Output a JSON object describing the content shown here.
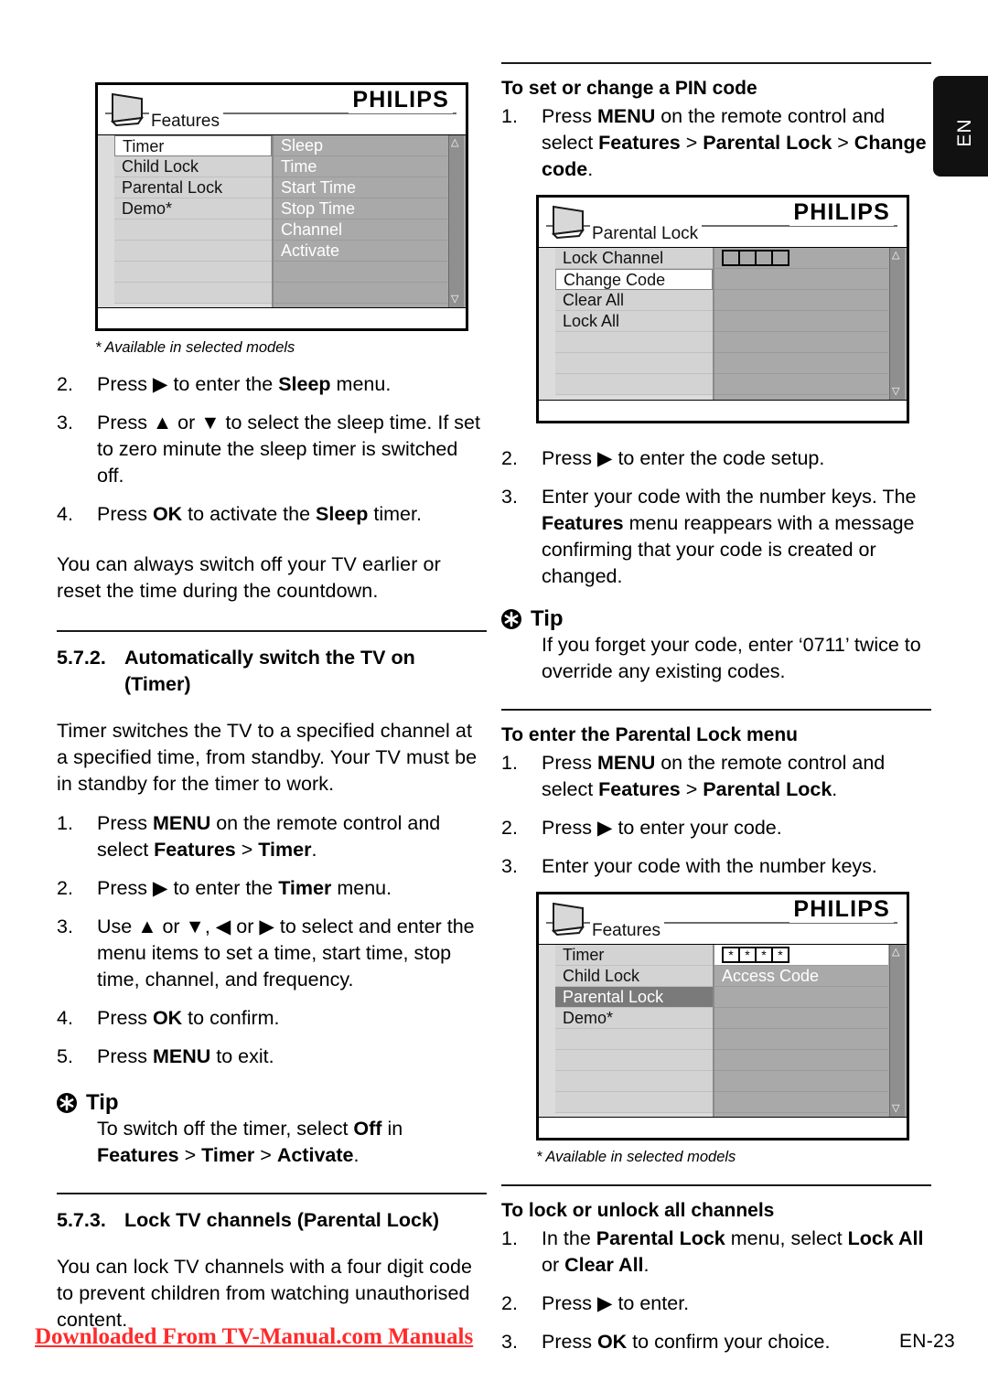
{
  "language_tab": {
    "label": "EN"
  },
  "footer": {
    "download_note": "Downloaded From TV-Manual.com Manuals",
    "page_number": "EN-23"
  },
  "osd_features_timer": {
    "title": "Features",
    "brand": "PHILIPS",
    "left_items": [
      "Timer",
      "Child Lock",
      "Parental Lock",
      "Demo*"
    ],
    "left_selected": "Timer",
    "right_items": [
      "Sleep",
      "Time",
      "Start Time",
      "Stop Time",
      "Channel",
      "Activate"
    ],
    "scroll_up": "△",
    "scroll_down": "▽",
    "note": "* Available in selected models"
  },
  "osd_parental_lock": {
    "title": "Parental Lock",
    "brand": "PHILIPS",
    "left_items": [
      "Lock Channel",
      "Change Code",
      "Clear All",
      "Lock All"
    ],
    "left_selected": "Change Code",
    "code_boxes": [
      "",
      "",
      "",
      ""
    ],
    "right_items": [],
    "scroll_up": "△",
    "scroll_down": "▽"
  },
  "osd_features_access": {
    "title": "Features",
    "brand": "PHILIPS",
    "left_items": [
      "Timer",
      "Child Lock",
      "Parental Lock",
      "Demo*"
    ],
    "left_selected": "Parental Lock",
    "code_boxes": [
      "*",
      "*",
      "*",
      "*"
    ],
    "right_items": [
      "Access Code"
    ],
    "scroll_up": "△",
    "scroll_down": "▽",
    "note": "* Available in selected models"
  },
  "left_column": {
    "sleep_steps": [
      {
        "num": "2.",
        "html": "Press ▶ to enter the <b>Sleep</b> menu."
      },
      {
        "num": "3.",
        "html": "Press ▲ or ▼ to select the sleep time. If set to zero minute the sleep timer is switched off."
      },
      {
        "num": "4.",
        "html": "Press <b>OK</b> to activate the <b>Sleep</b> timer."
      }
    ],
    "sleep_note": "You can always switch off your TV earlier or reset the time during the countdown.",
    "section_572": {
      "num": "5.7.2.",
      "title": "Automatically switch the TV on (Timer)"
    },
    "timer_intro": "Timer switches the TV to a specified channel at a specified time, from standby. Your TV must be in standby for the timer to work.",
    "timer_steps": [
      {
        "num": "1.",
        "html": "Press <b>MENU</b> on the remote control and select <b>Features</b> &gt; <b>Timer</b>."
      },
      {
        "num": "2.",
        "html": "Press ▶ to enter the <b>Timer</b> menu."
      },
      {
        "num": "3.",
        "html": "Use ▲ or ▼, ◀ or ▶ to select and enter the menu items to set a time, start time, stop time, channel, and frequency."
      },
      {
        "num": "4.",
        "html": "Press <b>OK</b> to confirm."
      },
      {
        "num": "5.",
        "html": "Press <b>MENU</b> to exit."
      }
    ],
    "tip": {
      "title": "Tip",
      "html": "To switch off the timer, select <b>Off</b> in <b>Features</b> &gt; <b>Timer</b> &gt; <b>Activate</b>."
    },
    "section_573": {
      "num": "5.7.3.",
      "title": "Lock TV channels (Parental Lock)"
    },
    "lock_intro": "You can lock TV channels with a four digit code to prevent children from watching unauthorised content."
  },
  "right_column": {
    "pin_heading": "To set or change a PIN code",
    "pin_step1": {
      "num": "1.",
      "html": "Press <b>MENU</b> on the remote control and select <b>Features</b> &gt; <b>Parental Lock</b> &gt; <b>Change code</b>."
    },
    "pin_steps": [
      {
        "num": "2.",
        "html": "Press ▶ to enter the code setup."
      },
      {
        "num": "3.",
        "html": "Enter your code with the number keys. The <b>Features</b> menu reappears with a message confirming that your code is created or changed."
      }
    ],
    "tip": {
      "title": "Tip",
      "html": "If you forget your code, enter ‘0711’ twice to override any existing codes."
    },
    "enter_heading": "To enter the Parental Lock menu",
    "enter_steps": [
      {
        "num": "1.",
        "html": "Press <b>MENU</b> on the remote control and select <b>Features</b> &gt; <b>Parental Lock</b>."
      },
      {
        "num": "2.",
        "html": "Press ▶ to enter your code."
      },
      {
        "num": "3.",
        "html": "Enter your code with the number keys."
      }
    ],
    "lockall_heading": "To lock or unlock all channels",
    "lockall_steps": [
      {
        "num": "1.",
        "html": "In the <b>Parental Lock</b> menu, select <b>Lock All</b> or <b>Clear All</b>."
      },
      {
        "num": "2.",
        "html": "Press ▶ to enter."
      },
      {
        "num": "3.",
        "html": "Press <b>OK</b> to confirm your choice."
      }
    ]
  }
}
